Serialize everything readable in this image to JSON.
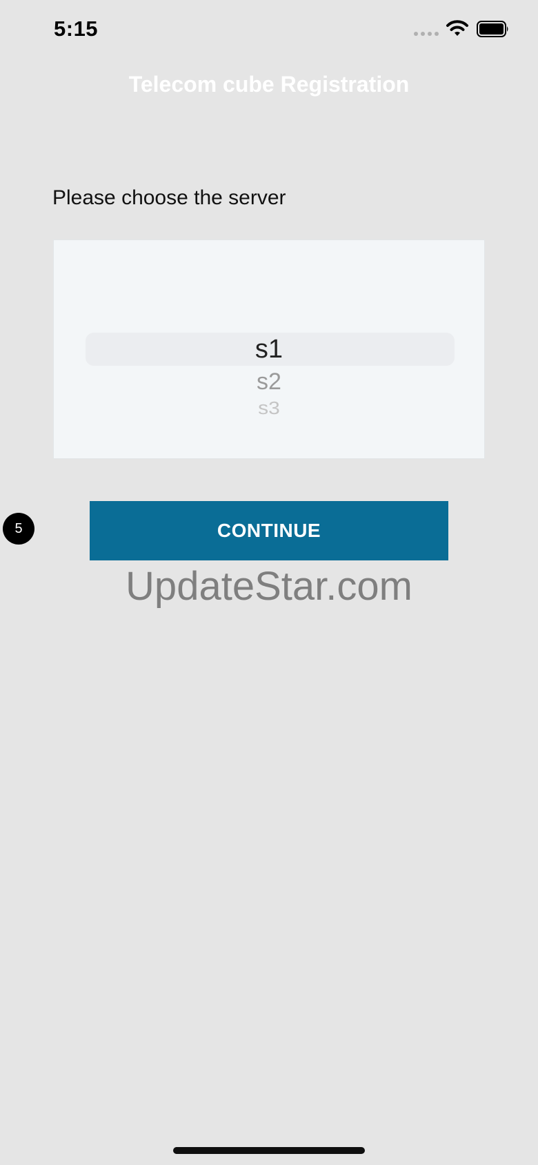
{
  "status_bar": {
    "time": "5:15",
    "icons": [
      "signal-dots-icon",
      "wifi-icon",
      "battery-icon"
    ]
  },
  "header": {
    "title": "Telecom cube Registration"
  },
  "form": {
    "prompt": "Please choose the server",
    "picker": {
      "options": [
        "s1",
        "s2",
        "s3"
      ],
      "selected": "s1"
    },
    "continue_label": "CONTINUE"
  },
  "step_badge": "5",
  "watermark": "UpdateStar.com",
  "colors": {
    "background": "#e5e5e5",
    "button": "#0a6d96",
    "picker_bg": "#f3f6f8"
  }
}
